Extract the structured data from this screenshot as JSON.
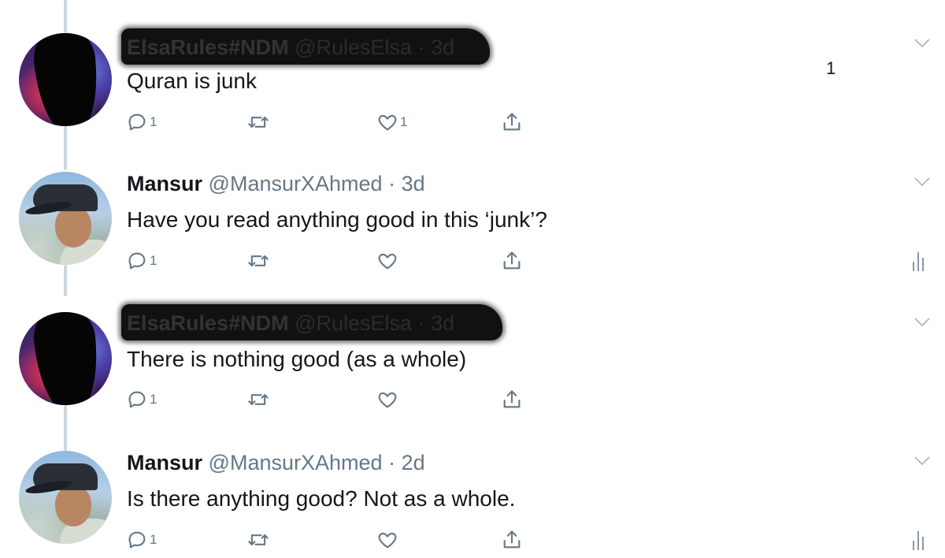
{
  "tweets": [
    {
      "name": "ElsaRules#NDM",
      "handle": "@RulesElsa",
      "separator": "·",
      "time": "3d",
      "text": "Quran is junk",
      "reply_count": "1",
      "retweet_count": "",
      "like_count": "1",
      "redacted": true,
      "show_analytics": false
    },
    {
      "name": "Mansur",
      "handle": "@MansurXAhmed",
      "separator": "·",
      "time": "3d",
      "text": "Have you read anything good in this ‘junk’?",
      "reply_count": "1",
      "retweet_count": "",
      "like_count": "",
      "redacted": false,
      "show_analytics": true
    },
    {
      "name": "ElsaRules#NDM",
      "handle": "@RulesElsa",
      "separator": "·",
      "time": "3d",
      "text": "There is nothing good (as a whole)",
      "reply_count": "1",
      "retweet_count": "",
      "like_count": "",
      "redacted": true,
      "show_analytics": false
    },
    {
      "name": "Mansur",
      "handle": "@MansurXAhmed",
      "separator": "·",
      "time": "2d",
      "text": "Is there anything good? Not as a whole.",
      "reply_count": "1",
      "retweet_count": "",
      "like_count": "",
      "redacted": false,
      "show_analytics": true
    }
  ],
  "corner_number": "1",
  "icons": {
    "reply": "reply-icon",
    "retweet": "retweet-icon",
    "like": "heart-icon",
    "share": "share-icon",
    "menu": "chevron-down-icon",
    "analytics": "analytics-icon"
  },
  "colors": {
    "text": "#14171a",
    "secondary": "#657786",
    "thread_line": "#ccd6dd"
  }
}
